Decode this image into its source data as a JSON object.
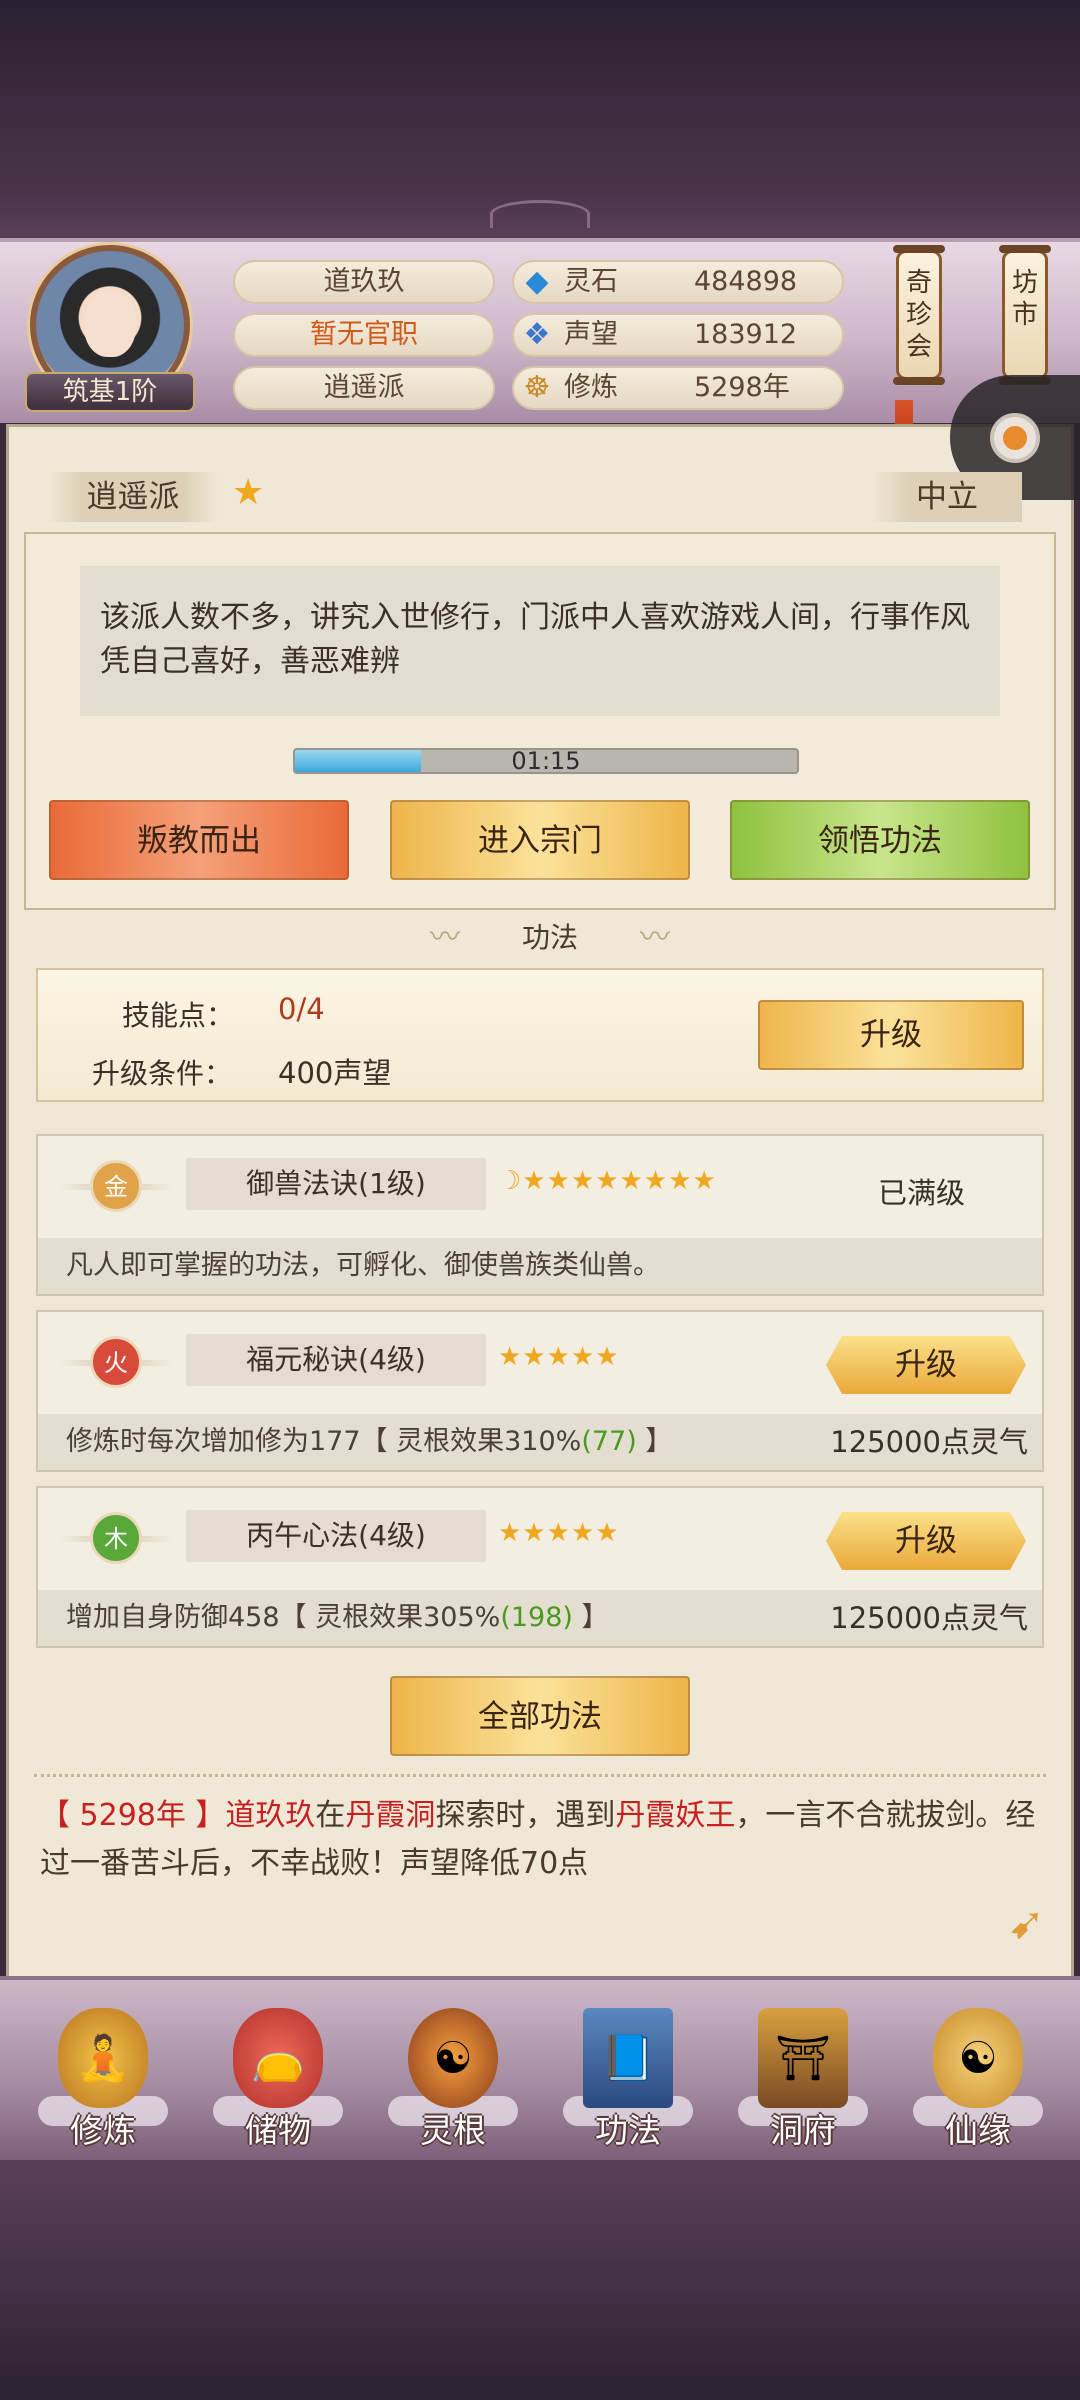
{
  "header": {
    "player_name": "道玖玖",
    "official_title": "暂无官职",
    "sect": "逍遥派",
    "rank": "筑基1阶",
    "resources": [
      {
        "label": "灵石",
        "value": "484898",
        "icon": "spirit-stone-icon"
      },
      {
        "label": "声望",
        "value": "183912",
        "icon": "prestige-icon"
      },
      {
        "label": "修炼",
        "value": "5298年",
        "icon": "meditation-icon"
      }
    ],
    "side_buttons": [
      {
        "label": "奇珍会"
      },
      {
        "label": "坊市"
      }
    ]
  },
  "sect_panel": {
    "name": "逍遥派",
    "alignment": "中立",
    "description": "该派人数不多，讲究入世修行，门派中人喜欢游戏人间，行事作风凭自己喜好，善恶难辨",
    "timer": "01:15",
    "timer_progress": 0.25,
    "buttons": [
      "叛教而出",
      "进入宗门",
      "领悟功法"
    ]
  },
  "skills_section": {
    "title": "功法",
    "skill_points_label": "技能点：",
    "skill_points_value": "0/4",
    "upgrade_cond_label": "升级条件：",
    "upgrade_cond_value": "400声望",
    "upgrade_button": "升级"
  },
  "skills": [
    {
      "element": "金",
      "name": "御兽法诀(1级)",
      "stars": "☽★★★★★★★★",
      "action": "",
      "status": "已满级",
      "desc_pre": "凡人即可掌握的功法，可孵化、御使兽族类仙兽。",
      "desc_green": "",
      "desc_post": "",
      "cost": ""
    },
    {
      "element": "火",
      "name": "福元秘诀(4级)",
      "stars": "★★★★★",
      "action": "升级",
      "status": "",
      "desc_pre": "修炼时每次增加修为177【 灵根效果310%",
      "desc_green": "(77)",
      "desc_post": " 】",
      "cost": "125000点灵气"
    },
    {
      "element": "木",
      "name": "丙午心法(4级)",
      "stars": "★★★★★",
      "action": "升级",
      "status": "",
      "desc_pre": "增加自身防御458【 灵根效果305%",
      "desc_green": "(198)",
      "desc_post": " 】",
      "cost": "125000点灵气"
    }
  ],
  "all_skills_button": "全部功法",
  "log": {
    "year": "【 5298年 】",
    "player": "道玖玖",
    "t1": "在",
    "place": "丹霞洞",
    "t2": "探索时，遇到",
    "enemy": "丹霞妖王",
    "t3": "，一言不合就拔剑。经过一番苦斗后，不幸战败！声望降低70点"
  },
  "nav": [
    {
      "label": "修炼",
      "icon": "cultivate-icon"
    },
    {
      "label": "储物",
      "icon": "storage-bag-icon"
    },
    {
      "label": "灵根",
      "icon": "spirit-root-icon"
    },
    {
      "label": "功法",
      "icon": "skill-book-icon"
    },
    {
      "label": "洞府",
      "icon": "cave-house-icon"
    },
    {
      "label": "仙缘",
      "icon": "fate-gourd-icon"
    }
  ],
  "colors": {
    "accent_red": "#c82020",
    "title_orange": "#d25a18",
    "positive_green": "#4a9a20",
    "star_gold": "#f0a820"
  }
}
